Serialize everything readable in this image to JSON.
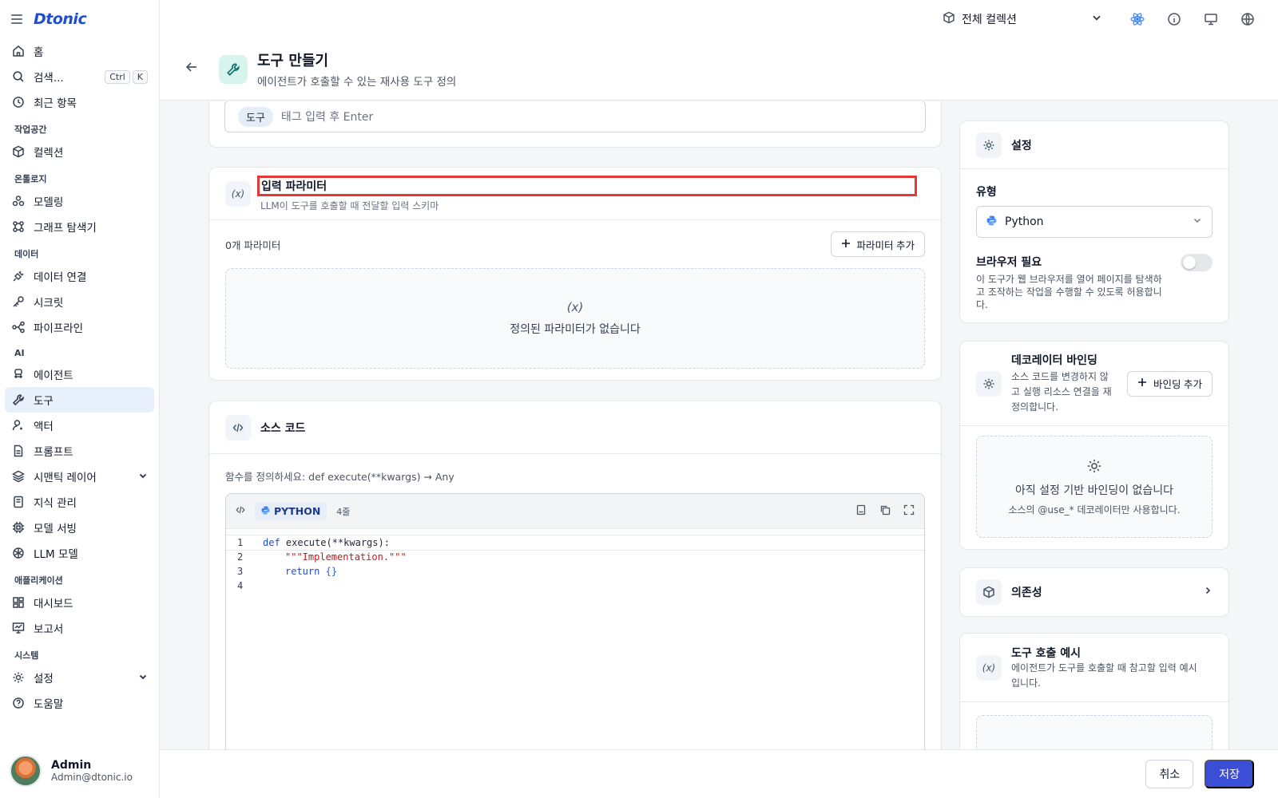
{
  "brand": {
    "logo": "Dtonic"
  },
  "sidebar": {
    "top_items": [
      {
        "label": "홈"
      },
      {
        "label": "검색...",
        "shortcut": [
          "Ctrl",
          "K"
        ]
      },
      {
        "label": "최근 항목"
      }
    ],
    "sections": {
      "workspace": "작업공간",
      "ontology": "온톨로지",
      "data": "데이터",
      "ai": "AI",
      "applications": "애플리케이션",
      "system": "시스템"
    },
    "items": {
      "collection": "컬렉션",
      "modeling": "모델링",
      "graph_explorer": "그래프 탐색기",
      "data_connection": "데이터 연결",
      "secrets": "시크릿",
      "pipeline": "파이프라인",
      "agent": "에이전트",
      "tool": "도구",
      "actor": "액터",
      "prompt": "프롬프트",
      "semantic_layer": "시맨틱 레이어",
      "knowledge": "지식 관리",
      "model_serving": "모델 서빙",
      "llm_model": "LLM 모델",
      "dashboard": "대시보드",
      "report": "보고서",
      "settings": "설정",
      "help": "도움말"
    },
    "user": {
      "name": "Admin",
      "email": "Admin@dtonic.io"
    }
  },
  "topbar": {
    "collection": "전체 컬렉션"
  },
  "header": {
    "title": "도구 만들기",
    "subtitle": "에이전트가 호출할 수 있는 재사용 도구 정의"
  },
  "tags": {
    "chip": "도구",
    "placeholder": "태그 입력 후 Enter"
  },
  "params": {
    "icon_text": "(x)",
    "title": "입력 파라미터",
    "subtitle": "LLM이 도구를 호출할 때 전달할 입력 스키마",
    "count": "0개 파라미터",
    "add_button": "파라미터 추가",
    "empty_icon": "(x)",
    "empty": "정의된 파라미터가 없습니다"
  },
  "source": {
    "title": "소스 코드",
    "hint": "함수를 정의하세요: def execute(**kwargs) → Any",
    "language": "PYTHON",
    "lines": "4줄",
    "code": {
      "l1_kw": "def",
      "l1_rest": " execute(**kwargs):",
      "l2": "\"\"\"Implementation.\"\"\"",
      "l3_kw": "return",
      "l3_rest": "{}"
    }
  },
  "settings": {
    "title": "설정",
    "type_label": "유형",
    "type_value": "Python",
    "browser_title": "브라우저 필요",
    "browser_desc": "이 도구가 웹 브라우저를 열어 페이지를 탐색하고 조작하는 작업을 수행할 수 있도록 허용합니다.",
    "browser_enabled": false
  },
  "decorator": {
    "title": "데코레이터 바인딩",
    "desc": "소스 코드를 변경하지 않고 실행 리소스 연결을 재정의합니다.",
    "add_button": "바인딩 추가",
    "empty_main": "아직 설정 기반 바인딩이 없습니다",
    "empty_sub": "소스의 @use_* 데코레이터만 사용합니다."
  },
  "dependencies": {
    "title": "의존성"
  },
  "example": {
    "icon_text": "(x)",
    "title": "도구 호출 예시",
    "desc": "에이전트가 도구를 호출할 때 참고할 입력 예시입니다."
  },
  "footer": {
    "cancel": "취소",
    "save": "저장"
  },
  "colors": {
    "accent": "#3b4fd6",
    "highlight": "#e53935",
    "active_nav": "#e7f0fb"
  }
}
